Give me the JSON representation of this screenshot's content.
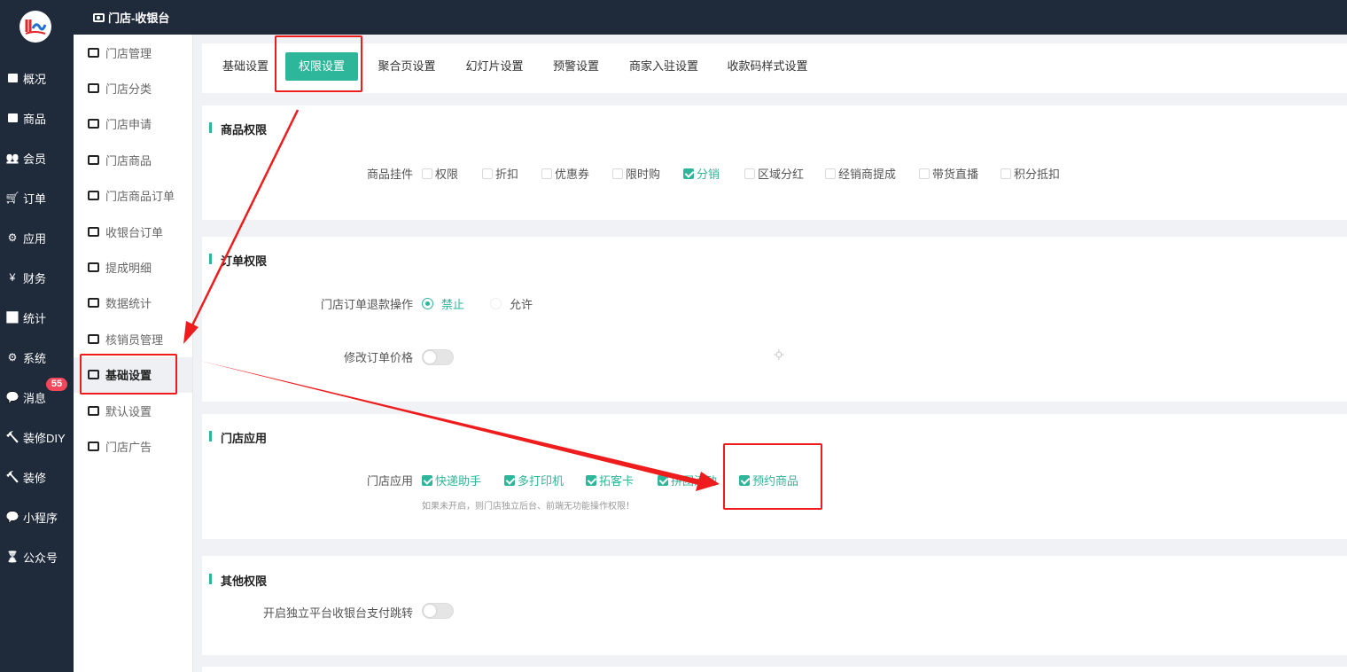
{
  "topbar": {
    "title": "门店-收银台"
  },
  "mainnav": [
    {
      "label": "概况",
      "icon": "dashboard-icon"
    },
    {
      "label": "商品",
      "icon": "goods-icon"
    },
    {
      "label": "会员",
      "icon": "users-icon"
    },
    {
      "label": "订单",
      "icon": "cart-icon"
    },
    {
      "label": "应用",
      "icon": "apps-icon"
    },
    {
      "label": "财务",
      "icon": "yen-icon"
    },
    {
      "label": "统计",
      "icon": "bar-chart-icon"
    },
    {
      "label": "系统",
      "icon": "gears-icon"
    },
    {
      "label": "消息",
      "icon": "chat-icon"
    },
    {
      "label": "装修DIY",
      "icon": "hammer-icon"
    },
    {
      "label": "装修",
      "icon": "hammer-icon"
    },
    {
      "label": "小程序",
      "icon": "wechat-icon"
    },
    {
      "label": "公众号",
      "icon": "hourglass-icon"
    }
  ],
  "message_badge": "55",
  "subnav": [
    {
      "label": "门店管理",
      "icon": "store-icon"
    },
    {
      "label": "门店分类",
      "icon": "category-icon"
    },
    {
      "label": "门店申请",
      "icon": "inbox-check-icon"
    },
    {
      "label": "门店商品",
      "icon": "bag-icon"
    },
    {
      "label": "门店商品订单",
      "icon": "clipboard-icon"
    },
    {
      "label": "收银台订单",
      "icon": "receipt-icon"
    },
    {
      "label": "提成明细",
      "icon": "ledger-icon"
    },
    {
      "label": "数据统计",
      "icon": "stats-icon"
    },
    {
      "label": "核销员管理",
      "icon": "user-gear-icon"
    },
    {
      "label": "基础设置",
      "icon": "gear-icon"
    },
    {
      "label": "默认设置",
      "icon": "list-settings-icon"
    },
    {
      "label": "门店广告",
      "icon": "ad-icon"
    }
  ],
  "tabs": [
    "基础设置",
    "权限设置",
    "聚合页设置",
    "幻灯片设置",
    "预警设置",
    "商家入驻设置",
    "收款码样式设置"
  ],
  "sections": {
    "goods": {
      "title": "商品权限",
      "label": "商品挂件",
      "options": [
        {
          "label": "权限",
          "checked": false
        },
        {
          "label": "折扣",
          "checked": false
        },
        {
          "label": "优惠券",
          "checked": false
        },
        {
          "label": "限时购",
          "checked": false
        },
        {
          "label": "分销",
          "checked": true
        },
        {
          "label": "区域分红",
          "checked": false
        },
        {
          "label": "经销商提成",
          "checked": false
        },
        {
          "label": "带货直播",
          "checked": false
        },
        {
          "label": "积分抵扣",
          "checked": false
        }
      ]
    },
    "order": {
      "title": "订单权限",
      "refund_label": "门店订单退款操作",
      "refund_options": [
        {
          "label": "禁止",
          "selected": true
        },
        {
          "label": "允许",
          "selected": false
        }
      ],
      "price_label": "修改订单价格",
      "price_enabled": false
    },
    "apps": {
      "title": "门店应用",
      "label": "门店应用",
      "options": [
        {
          "label": "快递助手",
          "checked": true
        },
        {
          "label": "多打印机",
          "checked": true
        },
        {
          "label": "拓客卡",
          "checked": true
        },
        {
          "label": "拼团活动",
          "checked": true
        },
        {
          "label": "预约商品",
          "checked": true
        }
      ],
      "hint": "如果未开启，则门店独立后台、前端无功能操作权限！"
    },
    "other": {
      "title": "其他权限",
      "jump_label": "开启独立平台收银台支付跳转",
      "jump_enabled": false
    }
  },
  "colors": {
    "accent": "#2db69a",
    "sidebar": "#1f2a3a",
    "annotation": "#ee1c1c",
    "badge": "#f5475b"
  }
}
